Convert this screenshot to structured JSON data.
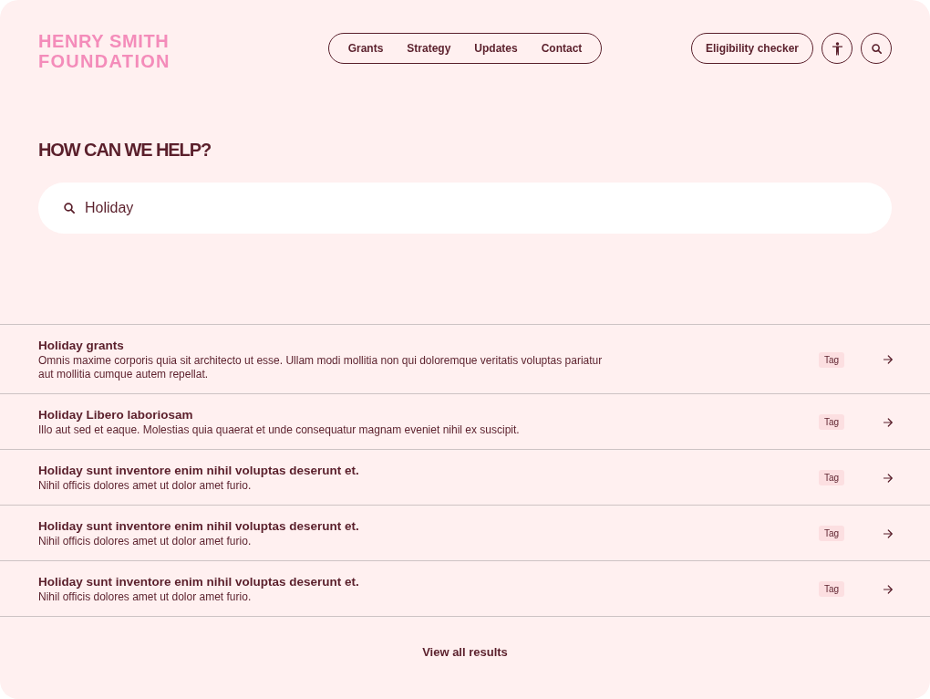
{
  "logo": {
    "line_1": "HENRY SMITH",
    "line_2": "FOUNDATION"
  },
  "nav": [
    {
      "label": "Grants"
    },
    {
      "label": "Strategy"
    },
    {
      "label": "Updates"
    },
    {
      "label": "Contact"
    }
  ],
  "header_actions": {
    "eligibility_button": "Eligibility checker"
  },
  "heading": "HOW CAN WE HELP?",
  "search": {
    "value": "Holiday"
  },
  "results": [
    {
      "title": "Holiday grants",
      "description": "Omnis maxime corporis quia sit architecto ut esse. Ullam modi mollitia non qui doloremque veritatis voluptas pariatur aut mollitia cumque autem repellat.",
      "tag": "Tag"
    },
    {
      "title": "Holiday Libero laboriosam",
      "description": "Illo aut sed et eaque. Molestias quia quaerat et unde consequatur magnam eveniet nihil ex suscipit.",
      "tag": "Tag"
    },
    {
      "title": "Holiday sunt inventore enim nihil voluptas deserunt et.",
      "description": "Nihil officis dolores amet ut dolor amet furio.",
      "tag": "Tag"
    },
    {
      "title": "Holiday sunt inventore enim nihil voluptas deserunt et.",
      "description": "Nihil officis dolores amet ut dolor amet furio.",
      "tag": "Tag"
    },
    {
      "title": "Holiday sunt inventore enim nihil voluptas deserunt et.",
      "description": "Nihil officis dolores amet ut dolor amet furio.",
      "tag": "Tag"
    }
  ],
  "view_all": "View all results"
}
